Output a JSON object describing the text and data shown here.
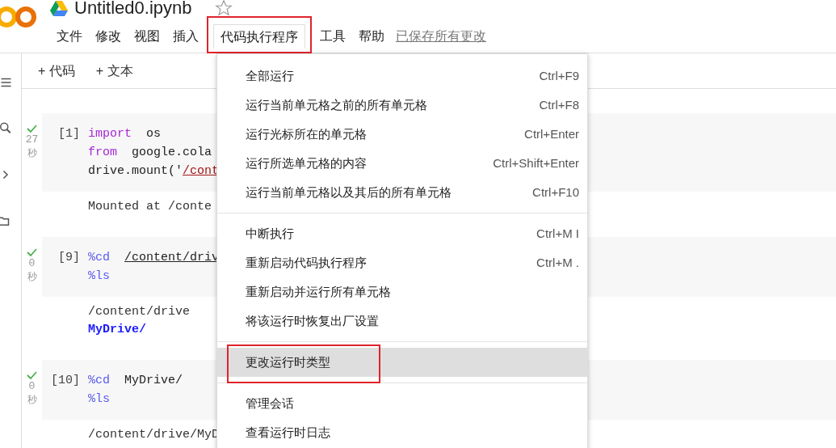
{
  "header": {
    "title": "Untitled0.ipynb",
    "starred": false
  },
  "menubar": [
    {
      "label": "文件",
      "selected": false
    },
    {
      "label": "修改",
      "selected": false
    },
    {
      "label": "视图",
      "selected": false
    },
    {
      "label": "插入",
      "selected": false
    },
    {
      "label": "代码执行程序",
      "selected": true,
      "highlighted": true
    },
    {
      "label": "工具",
      "selected": false
    },
    {
      "label": "帮助",
      "selected": false
    }
  ],
  "save_status": "已保存所有更改",
  "toolbar": [
    "+ 代码",
    "+ 文本"
  ],
  "cells": [
    {
      "count": "[1]",
      "time": "27",
      "unit": "秒",
      "done": true,
      "lines": [
        [
          {
            "kind": "keyword",
            "text": "import"
          },
          {
            "kind": "plain",
            "text": "  os"
          }
        ],
        [
          {
            "kind": "keyword",
            "text": "from"
          },
          {
            "kind": "plain",
            "text": "  google.cola"
          }
        ],
        [
          {
            "kind": "plain",
            "text": "drive.mount('"
          },
          {
            "kind": "path",
            "text": "/cont"
          }
        ]
      ],
      "output": [
        {
          "kind": "plain",
          "text": "Mounted at /conte"
        }
      ]
    },
    {
      "count": "[9]",
      "time": "0",
      "unit": "秒",
      "done": true,
      "lines": [
        [
          {
            "kind": "magic",
            "text": "%cd  "
          },
          {
            "kind": "link",
            "text": "/content/driv"
          }
        ],
        [
          {
            "kind": "magic",
            "text": "%ls"
          }
        ]
      ],
      "output": [
        {
          "kind": "plain",
          "text": "/content/drive"
        },
        {
          "kind": "dir",
          "text": "MyDrive/"
        }
      ]
    },
    {
      "count": "[10]",
      "time": "0",
      "unit": "秒",
      "done": true,
      "lines": [
        [
          {
            "kind": "magic",
            "text": "%cd"
          },
          {
            "kind": "plain",
            "text": "  MyDrive/"
          }
        ],
        [
          {
            "kind": "magic",
            "text": "%ls"
          }
        ]
      ],
      "output": [
        {
          "kind": "plain",
          "text": "/content/drive/MyD"
        }
      ]
    }
  ],
  "menu": {
    "groups": [
      [
        {
          "label": "全部运行",
          "shortcut": "Ctrl+F9",
          "selected": false,
          "highlighted": false
        },
        {
          "label": "运行当前单元格之前的所有单元格",
          "shortcut": "Ctrl+F8",
          "selected": false,
          "highlighted": false
        },
        {
          "label": "运行光标所在的单元格",
          "shortcut": "Ctrl+Enter",
          "selected": false,
          "highlighted": false
        },
        {
          "label": "运行所选单元格的内容",
          "shortcut": "Ctrl+Shift+Enter",
          "selected": false,
          "highlighted": false
        },
        {
          "label": "运行当前单元格以及其后的所有单元格",
          "shortcut": "Ctrl+F10",
          "selected": false,
          "highlighted": false
        }
      ],
      [
        {
          "label": "中断执行",
          "shortcut": "Ctrl+M I",
          "selected": false,
          "highlighted": false
        },
        {
          "label": "重新启动代码执行程序",
          "shortcut": "Ctrl+M .",
          "selected": false,
          "highlighted": false
        },
        {
          "label": "重新启动并运行所有单元格",
          "selected": false,
          "highlighted": false
        },
        {
          "label": "将该运行时恢复出厂设置",
          "selected": false,
          "highlighted": false
        }
      ],
      [
        {
          "label": "更改运行时类型",
          "selected": true,
          "highlighted": true
        }
      ],
      [
        {
          "label": "管理会话",
          "selected": false,
          "highlighted": false
        },
        {
          "label": "查看运行时日志",
          "selected": false,
          "highlighted": false
        }
      ]
    ]
  }
}
